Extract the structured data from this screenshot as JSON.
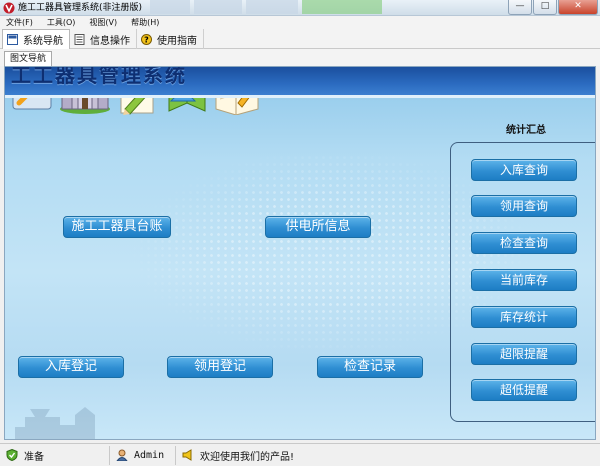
{
  "window": {
    "title": "施工工器具管理系统(非注册版)",
    "icons": {
      "app": "app-logo-icon",
      "minimize": "minimize-icon",
      "maximize": "maximize-icon",
      "close": "close-icon"
    }
  },
  "menu": {
    "items": [
      {
        "label": "文件(F)"
      },
      {
        "label": "工具(O)"
      },
      {
        "label": "视图(V)"
      },
      {
        "label": "帮助(H)"
      }
    ]
  },
  "nav_tabs": [
    {
      "label": "系统导航",
      "icon": "navigation-icon"
    },
    {
      "label": "信息操作",
      "icon": "document-icon"
    },
    {
      "label": "使用指南",
      "icon": "help-icon"
    }
  ],
  "doc_tab": {
    "label": "图文导航"
  },
  "main": {
    "header_title": "工工器具管理系统",
    "modules": [
      {
        "label": "施工工器具台账",
        "icon": "tools-ledger-icon"
      },
      {
        "label": "供电所信息",
        "icon": "castle-icon"
      },
      {
        "label": "入库登记",
        "icon": "register-pencil-icon"
      },
      {
        "label": "领用登记",
        "icon": "user-book-icon"
      },
      {
        "label": "检查记录",
        "icon": "notebook-pencil-icon"
      }
    ],
    "stats": {
      "title": "统计汇总",
      "buttons": [
        {
          "label": "入库查询"
        },
        {
          "label": "领用查询"
        },
        {
          "label": "检查查询"
        },
        {
          "label": "当前库存"
        },
        {
          "label": "库存统计"
        },
        {
          "label": "超限提醒"
        },
        {
          "label": "超低提醒"
        }
      ]
    }
  },
  "status": {
    "ready": "准备",
    "user": "Admin",
    "message": "欢迎使用我们的产品!"
  },
  "colors": {
    "button_blue": "#2f8ed2",
    "header_blue": "#1b4f9e",
    "panel_bg": "#b3dcf3"
  }
}
